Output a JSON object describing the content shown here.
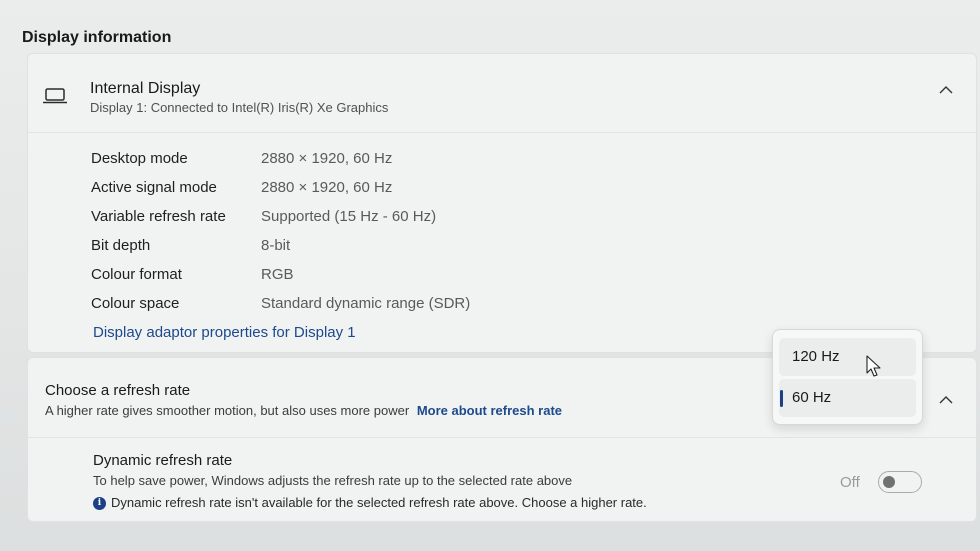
{
  "section_title": "Display information",
  "display": {
    "name": "Internal Display",
    "subtitle": "Display 1: Connected to Intel(R) Iris(R) Xe Graphics",
    "rows": [
      {
        "label": "Desktop mode",
        "value": "2880 × 1920, 60 Hz"
      },
      {
        "label": "Active signal mode",
        "value": "2880 × 1920, 60 Hz"
      },
      {
        "label": "Variable refresh rate",
        "value": "Supported (15 Hz - 60 Hz)"
      },
      {
        "label": "Bit depth",
        "value": "8-bit"
      },
      {
        "label": "Colour format",
        "value": "RGB"
      },
      {
        "label": "Colour space",
        "value": "Standard dynamic range (SDR)"
      }
    ],
    "adaptor_link": "Display adaptor properties for Display 1"
  },
  "refresh": {
    "title": "Choose a refresh rate",
    "subtitle": "A higher rate gives smoother motion, but also uses more power",
    "more_link": "More about refresh rate",
    "options": [
      "120 Hz",
      "60 Hz"
    ],
    "selected": "60 Hz"
  },
  "dynamic": {
    "title": "Dynamic refresh rate",
    "subtitle": "To help save power, Windows adjusts the refresh rate up to the selected rate above",
    "note": "Dynamic refresh rate isn't available for the selected refresh rate above. Choose a higher rate.",
    "info_glyph": "i",
    "toggle_label": "Off"
  },
  "colors": {
    "accent": "#1c3f86",
    "link": "#1c4a8c"
  },
  "icons": [
    "laptop-icon",
    "chevron-up-icon",
    "info-icon",
    "mouse-cursor-icon"
  ]
}
